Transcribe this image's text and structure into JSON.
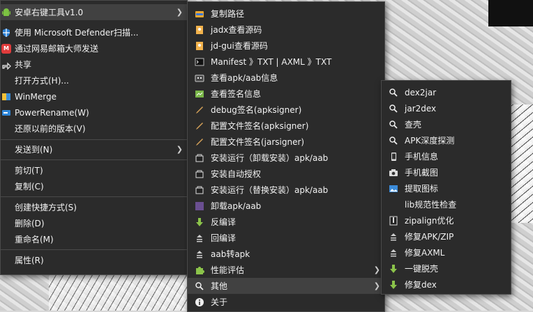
{
  "main_menu": {
    "items": [
      {
        "label": "安卓右键工具v1.0",
        "icon": "android-icon",
        "submenu": true,
        "highlighted": true
      },
      {
        "label": "使用 Microsoft Defender扫描...",
        "icon": "defender-shield-icon"
      },
      {
        "label": "通过网易邮箱大师发送",
        "icon": "netease-mail-icon"
      },
      {
        "label": "共享",
        "icon": "share-icon"
      },
      {
        "label": "打开方式(H)...",
        "icon": ""
      },
      {
        "label": "WinMerge",
        "icon": "winmerge-icon"
      },
      {
        "label": "PowerRename(W)",
        "icon": "powerrename-icon"
      },
      {
        "label": "还原以前的版本(V)",
        "icon": ""
      },
      {
        "label": "发送到(N)",
        "icon": "",
        "submenu": true
      },
      {
        "label": "剪切(T)",
        "icon": ""
      },
      {
        "label": "复制(C)",
        "icon": ""
      },
      {
        "label": "创建快捷方式(S)",
        "icon": ""
      },
      {
        "label": "删除(D)",
        "icon": ""
      },
      {
        "label": "重命名(M)",
        "icon": ""
      },
      {
        "label": "属性(R)",
        "icon": ""
      }
    ]
  },
  "tool_menu": {
    "items": [
      {
        "label": "复制路径",
        "icon": "copy-path-icon"
      },
      {
        "label": "jadx查看源码",
        "icon": "jadx-icon"
      },
      {
        "label": "jd-gui查看源码",
        "icon": "jd-gui-icon"
      },
      {
        "label": "Manifest 》TXT | AXML 》TXT",
        "icon": "terminal-icon"
      },
      {
        "label": "查看apk/aab信息",
        "icon": "apk-info-icon"
      },
      {
        "label": "查看签名信息",
        "icon": "signature-info-icon"
      },
      {
        "label": "debug签名(apksigner)",
        "icon": "pen-icon"
      },
      {
        "label": "配置文件签名(apksigner)",
        "icon": "pen-icon"
      },
      {
        "label": "配置文件签名(jarsigner)",
        "icon": "pen-icon"
      },
      {
        "label": "安装运行（卸载安装）apk/aab",
        "icon": "install-icon"
      },
      {
        "label": "安装自动授权",
        "icon": "install-icon"
      },
      {
        "label": "安装运行（替换安装）apk/aab",
        "icon": "install-icon"
      },
      {
        "label": "卸载apk/aab",
        "icon": "uninstall-icon"
      },
      {
        "label": "反编译",
        "icon": "decompile-arrow-icon"
      },
      {
        "label": "回编译",
        "icon": "recompile-icon"
      },
      {
        "label": "aab转apk",
        "icon": "convert-icon"
      },
      {
        "label": "性能评估",
        "icon": "puzzle-icon",
        "submenu": true
      },
      {
        "label": "其他",
        "icon": "search-icon",
        "submenu": true,
        "highlighted": true
      },
      {
        "label": "关于",
        "icon": "info-icon"
      }
    ]
  },
  "other_menu": {
    "items": [
      {
        "label": "dex2jar",
        "icon": "search-icon"
      },
      {
        "label": "jar2dex",
        "icon": "search-icon"
      },
      {
        "label": "查壳",
        "icon": "search-icon"
      },
      {
        "label": "APK深度探测",
        "icon": "search-icon"
      },
      {
        "label": "手机信息",
        "icon": "phone-icon"
      },
      {
        "label": "手机截图",
        "icon": "camera-icon"
      },
      {
        "label": "提取图标",
        "icon": "image-icon"
      },
      {
        "label": "lib规范性检查",
        "icon": ""
      },
      {
        "label": "zipalign优化",
        "icon": "zipalign-icon"
      },
      {
        "label": "修复APK/ZIP",
        "icon": "repair-icon"
      },
      {
        "label": "修复AXML",
        "icon": "repair-icon"
      },
      {
        "label": "一键脱壳",
        "icon": "unpack-arrow-icon"
      },
      {
        "label": "修复dex",
        "icon": "unpack-arrow-icon"
      }
    ]
  },
  "colors": {
    "menu_bg": "#2b2b2b",
    "highlight": "#414141",
    "border": "#4a4a4a",
    "text": "#f2f2f2"
  }
}
